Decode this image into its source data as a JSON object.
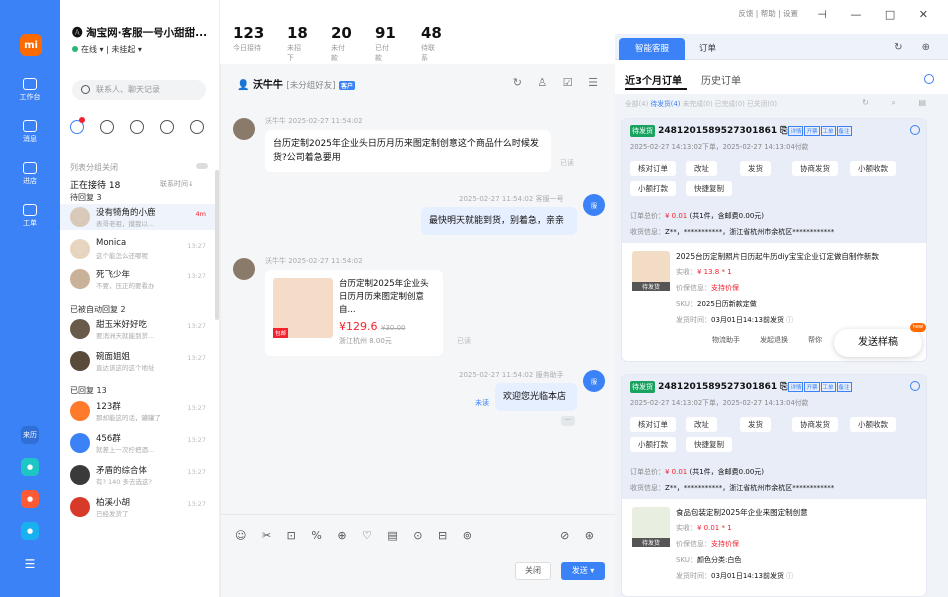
{
  "rail": {
    "items": [
      "工作台",
      "消息",
      "进店",
      "工单"
    ],
    "logo": "mi",
    "bottom_tag": "来历"
  },
  "shop": {
    "title": "淘宝网·客服一号小甜甜...",
    "status": "在线",
    "status2": "未挂起"
  },
  "stats": [
    {
      "n": "123",
      "l": "今日接待"
    },
    {
      "n": "18",
      "l": "未招下"
    },
    {
      "n": "20",
      "l": "未付款"
    },
    {
      "n": "91",
      "l": "已付款"
    },
    {
      "n": "48",
      "l": "待联系"
    }
  ],
  "search": {
    "placeholder": "联系人、聊天记录"
  },
  "list": {
    "tip": "列表分组关闭",
    "receiving": "正在接待 18",
    "sort": "联系时间↓",
    "waiting": "待回复 3",
    "auto": "已被自动回复 2",
    "replied": "已回复 13",
    "items": [
      {
        "name": "没有犄角的小鹿",
        "preview": "表哥老祖，摸我以...",
        "time": "4m"
      },
      {
        "name": "Monica",
        "preview": "这个能怎么还哪呢",
        "time": "13:27"
      },
      {
        "name": "死飞少年",
        "preview": "不要，压正的要看办",
        "time": "13:27"
      },
      {
        "name": "甜玉米好好吃",
        "preview": "要消洲天就能到货...",
        "time": "13:27"
      },
      {
        "name": "碗面姐姐",
        "preview": "直达该这的这个地址",
        "time": "13:27"
      },
      {
        "name": "123群",
        "preview": "那却能这的话，罐罐了",
        "time": "13:27"
      },
      {
        "name": "456群",
        "preview": "就差上一次拧把酒...",
        "time": "13:27"
      },
      {
        "name": "矛盾的综合体",
        "preview": "有? 140 多去选这?",
        "time": "13:27"
      },
      {
        "name": "柏溪小胡",
        "preview": "已经发货了",
        "time": "13:27"
      }
    ]
  },
  "chat": {
    "name": "沃牛牛",
    "group": "[未分组好友]",
    "tag": "客户",
    "m1_meta": "沃牛牛  2025-02-27  11:54:02",
    "m1": "台历定制2025年企业头日历月历来图定制创意这个商品什么时候发货?公司着急要用",
    "read": "已读",
    "m2_meta": "2025-02-27  11:54:02  客服一号",
    "m2": "最快明天就能到货，别着急，亲亲",
    "m3_meta": "沃牛牛  2025-02-27  11:54:02",
    "p_title": "台历定制2025年企业头日历月历来图定制创意自...",
    "p_price": "¥129.6",
    "p_old": "¥30.00",
    "p_ship": "浙江杭州  8.00元",
    "read2": "已读",
    "m4_meta": "2025-02-27  11:54:02  服务助手",
    "m4": "欢迎您光临本店",
    "unread": "未读",
    "bot": "服",
    "close": "关闭",
    "send": "发送"
  },
  "toplinks": "反馈  |  帮助  |  设置",
  "right": {
    "tab1": "智能客服",
    "tab2": "订单",
    "h1": "近3个月订单",
    "h2": "历史订单",
    "filters_active": "待发货(4)",
    "filters_pre": "全部(4)",
    "filters_post": "未完成(0)  已完成(0)  已关闭(0)",
    "orders": [
      {
        "status": "待发货",
        "id": "2481201589527301861",
        "time": "2025-02-27 14:13:02下单，2025-02-27 14:13:04付款",
        "actions": [
          "核对订单",
          "改址",
          "发货",
          "协商发货",
          "小额收款",
          "小额打款",
          "快捷复制"
        ],
        "total": "¥ 0.01",
        "total_rest": "(共1件，含邮费0.00元)",
        "addr": "Z**，***********，浙江省杭州市余杭区************",
        "p_name": "2025台历定制照片日历起牛历diy宝宝企业订定做自制作新款",
        "p_price": "¥ 13.8 * 1",
        "p_guard": "支持价保",
        "p_sku": "2025日历新款定做",
        "p_ship": "03月01日14:13前发货",
        "tools": [
          "物流助手",
          "发起退换",
          "帮你"
        ]
      },
      {
        "status": "待发货",
        "id": "2481201589527301861",
        "time": "2025-02-27 14:13:02下单，2025-02-27 14:13:04付款",
        "actions": [
          "核对订单",
          "改址",
          "发货",
          "协商发货",
          "小额收款",
          "小额打款",
          "快捷复制"
        ],
        "total": "¥ 0.01",
        "total_rest": "(共1件，含邮费0.00元)",
        "addr": "Z**，***********，浙江省杭州市余杭区************",
        "p_name": "食品包装定制2025年企业来图定制创意",
        "p_price": "¥ 0.01 * 1",
        "p_guard": "支持价保",
        "p_sku": "颜色分类:白色",
        "p_ship": "03月01日14:13前发货"
      }
    ],
    "float": "发送样稿",
    "float_new": "new"
  }
}
